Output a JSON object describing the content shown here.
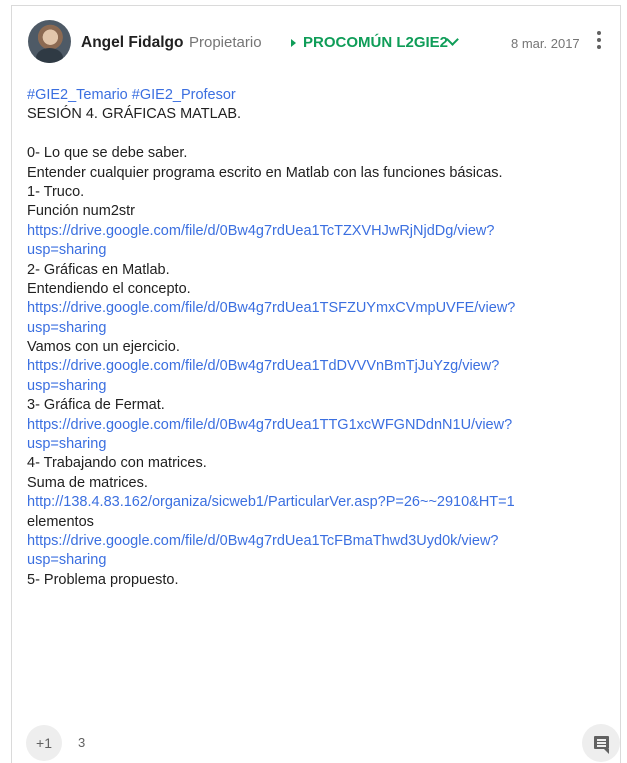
{
  "post": {
    "author": "Angel Fidalgo",
    "role": "Propietario",
    "community": "PROCOMÚN L2GIE2",
    "date": "8 mar. 2017",
    "icons": {
      "avatar": "author-avatar",
      "arrow": "arrow-right-icon",
      "chevron": "chevron-down-icon",
      "menu": "more-vert-icon",
      "comment": "comment-icon"
    },
    "colors": {
      "community": "#0f9d58",
      "link": "#3b6fe0",
      "muted": "#757575"
    },
    "lines": [
      {
        "text": "#GIE2_Temario #GIE2_Profesor",
        "type": "tags"
      },
      {
        "text": "SESIÓN 4. GRÁFICAS MATLAB.",
        "type": "plain"
      },
      {
        "text": "",
        "type": "plain"
      },
      {
        "text": "0-    Lo que se debe saber.",
        "type": "plain"
      },
      {
        "text": "   Entender cualquier programa escrito en Matlab con las funciones básicas.",
        "type": "plain"
      },
      {
        "text": "1-    Truco.",
        "type": "plain"
      },
      {
        "text": "   Función num2str",
        "type": "plain"
      },
      {
        "text": "https://drive.google.com/file/d/0Bw4g7rdUea1TcTZXVHJwRjNjdDg/view?",
        "type": "link"
      },
      {
        "text": "usp=sharing",
        "type": "link"
      },
      {
        "text": "2-    Gráficas en Matlab.",
        "type": "plain"
      },
      {
        "text": "   Entendiendo el concepto.",
        "type": "plain"
      },
      {
        "text": "https://drive.google.com/file/d/0Bw4g7rdUea1TSFZUYmxCVmpUVFE/view?",
        "type": "link"
      },
      {
        "text": "usp=sharing",
        "type": "link"
      },
      {
        "text": "   Vamos con un ejercicio.",
        "type": "plain"
      },
      {
        "text": "https://drive.google.com/file/d/0Bw4g7rdUea1TdDVVVnBmTjJuYzg/view?",
        "type": "link"
      },
      {
        "text": "usp=sharing",
        "type": "link"
      },
      {
        "text": "3-    Gráfica de Fermat.",
        "type": "plain"
      },
      {
        "text": "https://drive.google.com/file/d/0Bw4g7rdUea1TTG1xcWFGNDdnN1U/view?",
        "type": "link"
      },
      {
        "text": "usp=sharing",
        "type": "link"
      },
      {
        "text": "4-    Trabajando con matrices.",
        "type": "plain"
      },
      {
        "text": "    Suma de matrices.",
        "type": "plain"
      },
      {
        "text": "http://138.4.83.162/organiza/sicweb1/ParticularVer.asp?P=26~~2910&HT=1",
        "type": "link"
      },
      {
        "text": "       elementos",
        "type": "plain"
      },
      {
        "text": "https://drive.google.com/file/d/0Bw4g7rdUea1TcFBmaThwd3Uyd0k/view?",
        "type": "link"
      },
      {
        "text": "usp=sharing",
        "type": "link"
      },
      {
        "text": "5-    Problema propuesto.",
        "type": "plain"
      }
    ],
    "plus_one_label": "+1",
    "plus_one_count": "3"
  }
}
